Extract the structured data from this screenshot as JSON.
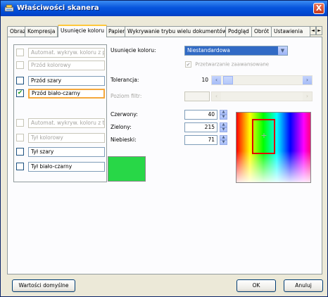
{
  "window": {
    "title": "Właściwości skanera",
    "close_label": "X"
  },
  "tabs": [
    {
      "label": "Obraz"
    },
    {
      "label": "Kompresja"
    },
    {
      "label": "Usunięcie koloru",
      "active": true
    },
    {
      "label": "Papier"
    },
    {
      "label": "Wykrywanie trybu wielu dokumentów"
    },
    {
      "label": "Podgląd"
    },
    {
      "label": "Obrót"
    },
    {
      "label": "Ustawienia"
    }
  ],
  "tab_scroll": {
    "left": "◄",
    "right": "►"
  },
  "image_list": [
    {
      "label": "Automat. wykryw. koloru z prz",
      "checked": false,
      "enabled": false
    },
    {
      "label": "Przód kolorowy",
      "checked": false,
      "enabled": false
    },
    {
      "label": "Przód szary",
      "checked": false,
      "enabled": true
    },
    {
      "label": "Przód biało-czarny",
      "checked": true,
      "enabled": true,
      "selected": true
    },
    {
      "label": "Automat. wykryw. koloru z tyłu",
      "checked": false,
      "enabled": false
    },
    {
      "label": "Tył kolorowy",
      "checked": false,
      "enabled": false
    },
    {
      "label": "Tył szary",
      "checked": false,
      "enabled": true
    },
    {
      "label": "Tył biało-czarny",
      "checked": false,
      "enabled": true
    }
  ],
  "color_removal": {
    "label": "Usunięcie koloru:",
    "value": "Niestandardowa",
    "advanced_label": "Przetwarzanie zaawansowane",
    "advanced_checked": true
  },
  "tolerance": {
    "label": "Tolerancja:",
    "value": "10"
  },
  "fill_level": {
    "label": "Poziom filtr:",
    "value": ""
  },
  "rgb": {
    "red_label": "Czerwony:",
    "red": "40",
    "green_label": "Zielony:",
    "green": "215",
    "blue_label": "Niebieski:",
    "blue": "71"
  },
  "colors": {
    "swatch": "#28d747",
    "accent": "#316ac5",
    "focus": "#f5a83c",
    "picker": "#e00000"
  },
  "buttons": {
    "defaults": "Wartości domyślne",
    "ok": "OK",
    "cancel": "Anuluj"
  }
}
